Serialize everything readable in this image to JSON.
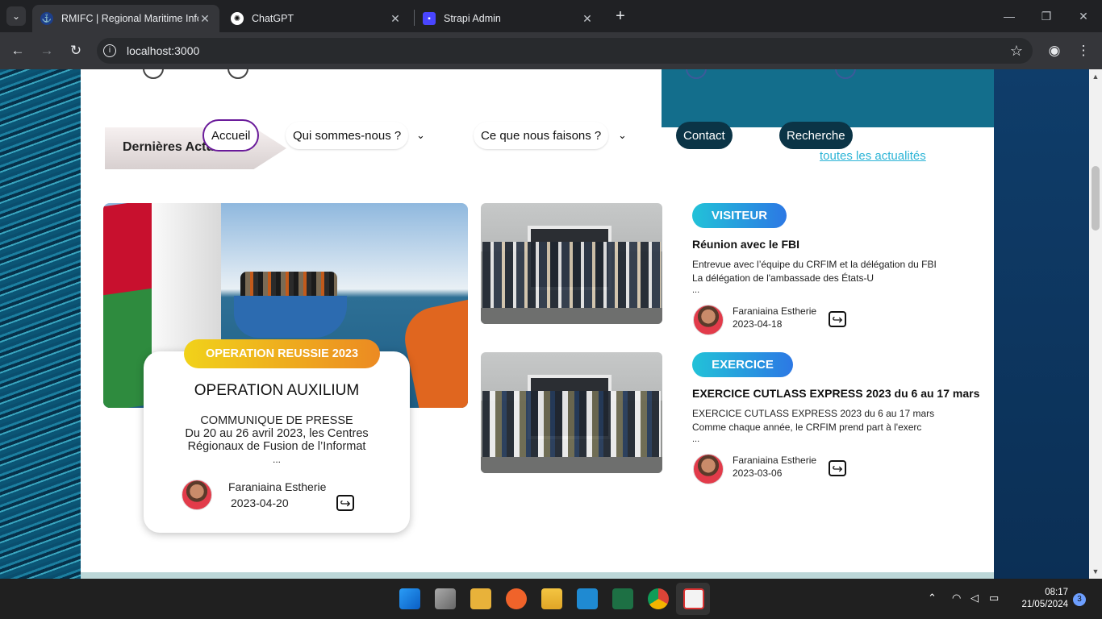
{
  "browser": {
    "tabs": [
      {
        "title": "RMIFC | Regional Maritime Infor"
      },
      {
        "title": "ChatGPT"
      },
      {
        "title": "Strapi Admin"
      }
    ],
    "url": "localhost:3000"
  },
  "nav": {
    "accueil": "Accueil",
    "qui": "Qui sommes-nous ?",
    "que": "Ce que nous faisons ?",
    "contact": "Contact",
    "recherche": "Recherche"
  },
  "section": {
    "banner": "Dernières Actualités",
    "all_link": "toutes les actualités"
  },
  "featured": {
    "tag": "OPERATION REUSSIE 2023",
    "title": "OPERATION AUXILIUM",
    "line1": "COMMUNIQUE DE PRESSE",
    "line2": "Du 20 au 26 avril 2023, les Centres",
    "line3": "Régionaux de Fusion de l’Informat",
    "ellipsis": "...",
    "author": "Faraniaina Estherie",
    "date": "2023-04-20"
  },
  "side_items": [
    {
      "badge": "VISITEUR",
      "title": "Réunion avec le FBI",
      "line1": "Entrevue avec l’équipe du CRFIM et la délégation du FBI",
      "line2": "La délégation de l'ambassade des États-U",
      "ellipsis": "...",
      "author": "Faraniaina Estherie",
      "date": "2023-04-18"
    },
    {
      "badge": "EXERCICE",
      "title": "EXERCICE CUTLASS EXPRESS 2023 du 6 au 17 mars",
      "line1": "EXERCICE CUTLASS EXPRESS 2023 du 6 au 17 mars",
      "line2": "Comme chaque année, le CRFIM prend part à l'exerc",
      "ellipsis": "...",
      "author": "Faraniaina Estherie",
      "date": "2023-03-06"
    }
  ],
  "taskbar": {
    "time": "08:17",
    "date": "21/05/2024",
    "notifications": "3"
  },
  "colors": {
    "accent_teal": "#136e8c",
    "nav_dark": "#0b3446",
    "link": "#2bb4d6",
    "tag_yellow": "#f1d21a",
    "tag_orange": "#ec8a22",
    "badge_start": "#22c2d8",
    "badge_end": "#2c78e4"
  }
}
